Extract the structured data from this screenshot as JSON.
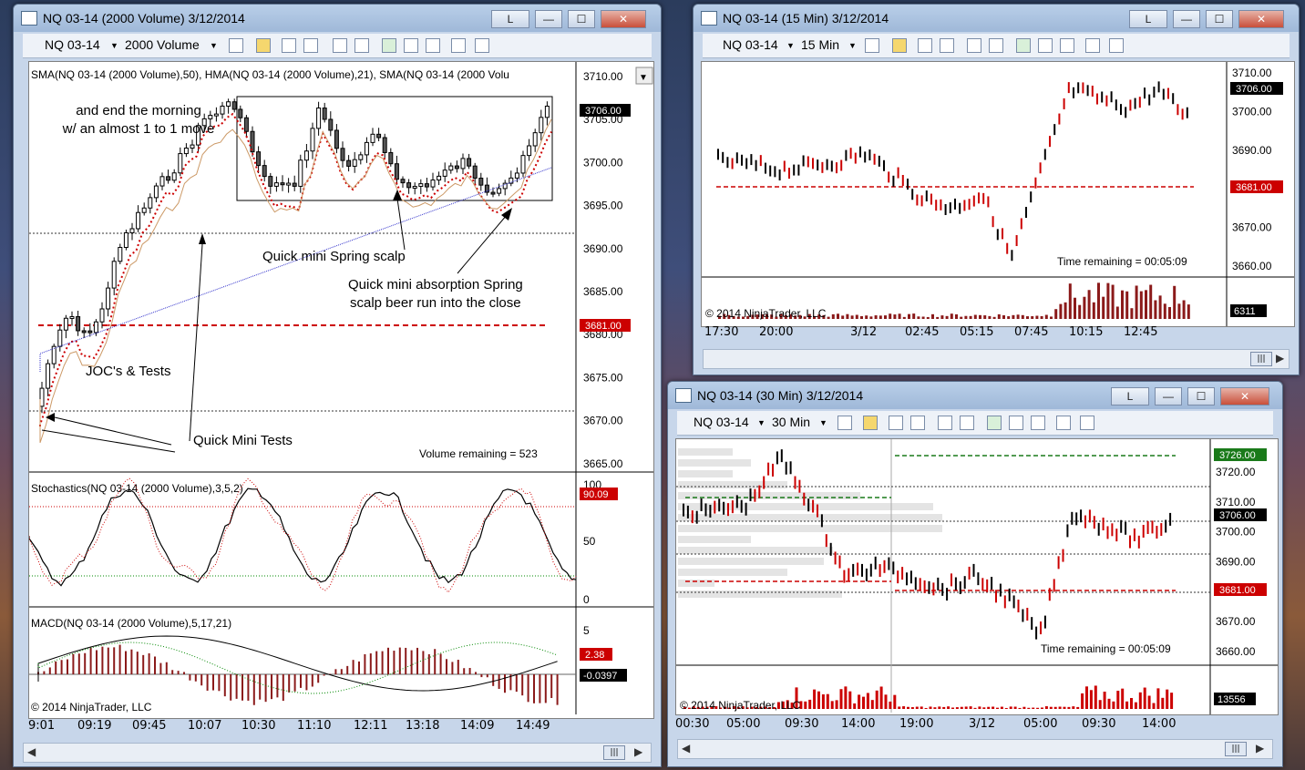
{
  "win1": {
    "title": "NQ 03-14 (2000 Volume)  3/12/2014",
    "btn_l": "L",
    "instrument": "NQ 03-14",
    "period": "2000 Volume",
    "indicator_header": "SMA(NQ 03-14  (2000  Volume),50), HMA(NQ 03-14  (2000  Volume),21), SMA(NQ 03-14  (2000  Volu",
    "price_axis": [
      "3710.00",
      "3705.00",
      "3700.00",
      "3695.00",
      "3690.00",
      "3685.00",
      "3680.00",
      "3675.00",
      "3670.00",
      "3665.00"
    ],
    "price_tag_last": "3706.00",
    "price_tag_level": "3681.00",
    "annotations": {
      "morning": "and end the morning",
      "morning2": "w/ an almost 1 to 1 move",
      "spring": "Quick mini Spring scalp",
      "absorption1": "Quick mini absorption Spring",
      "absorption2": "scalp beer run into the close",
      "joc": "JOC's & Tests",
      "tests": "Quick Mini Tests"
    },
    "volume_remaining": "Volume remaining = 523",
    "stoch_label": "Stochastics(NQ 03-14  (2000  Volume),3,5,2)",
    "stoch_axis": [
      "100",
      "50",
      "0"
    ],
    "stoch_tag": "90.09",
    "macd_label": "MACD(NQ 03-14  (2000  Volume),5,17,21)",
    "macd_axis": [
      "5"
    ],
    "macd_tag1": "2.38",
    "macd_tag2": "-0.0397",
    "copyright": "© 2014 NinjaTrader, LLC",
    "time_axis": [
      "9:01",
      "09:19",
      "09:45",
      "10:07",
      "10:30",
      "11:10",
      "12:11",
      "13:18",
      "14:09",
      "14:49"
    ]
  },
  "win2": {
    "title": "NQ 03-14 (15 Min)  3/12/2014",
    "btn_l": "L",
    "instrument": "NQ 03-14",
    "period": "15 Min",
    "price_axis": [
      "3710.00",
      "3700.00",
      "3690.00",
      "3680.00",
      "3670.00",
      "3660.00"
    ],
    "price_tag_last": "3706.00",
    "price_tag_level": "3681.00",
    "time_remaining": "Time remaining = 00:05:09",
    "copyright": "© 2014 NinjaTrader, LLC",
    "volume_tag": "6311",
    "time_axis": [
      "17:30",
      "20:00",
      "3/12",
      "02:45",
      "05:15",
      "07:45",
      "10:15",
      "12:45"
    ]
  },
  "win3": {
    "title": "NQ 03-14 (30 Min)  3/12/2014",
    "btn_l": "L",
    "instrument": "NQ 03-14",
    "period": "30 Min",
    "price_axis": [
      "3720.00",
      "3710.00",
      "3700.00",
      "3690.00",
      "3680.00",
      "3670.00",
      "3660.00"
    ],
    "price_tag_top": "3726.00",
    "price_tag_last": "3706.00",
    "price_tag_level": "3681.00",
    "time_remaining": "Time remaining = 00:05:09",
    "copyright": "© 2014 NinjaTrader, LLC",
    "volume_tag": "13556",
    "time_axis": [
      "00:30",
      "05:00",
      "09:30",
      "14:00",
      "19:00",
      "3/12",
      "05:00",
      "09:30",
      "14:00"
    ]
  },
  "colors": {
    "bull": "#000000",
    "bear": "#c00000",
    "level_line": "#cc0000",
    "tag_red": "#cc0000",
    "tag_black": "#000000",
    "tag_green": "#1a7a1a"
  },
  "icons": [
    "chart-icon",
    "pencil-icon",
    "zoom-icon",
    "crosshair-icon",
    "bar-style-icon",
    "properties-icon"
  ]
}
